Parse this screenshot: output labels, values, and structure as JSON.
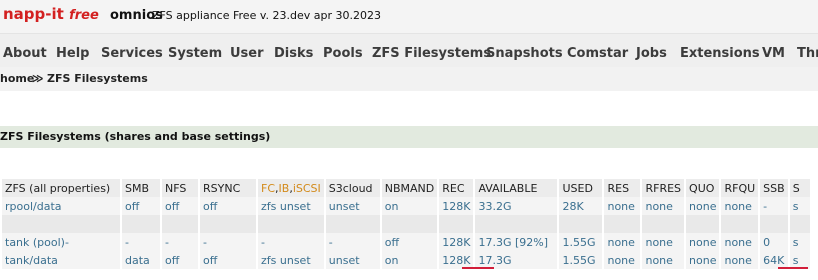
{
  "header": {
    "logo_napp": "napp-it",
    "logo_free": "free",
    "logo_omnios": "omnios",
    "version": "ZFS appliance Free v. 23.dev apr 30.2023"
  },
  "nav": [
    "About",
    "Help",
    "Services",
    "System",
    "User",
    "Disks",
    "Pools",
    "ZFS Filesystems",
    "Snapshots",
    "Comstar",
    "Jobs",
    "Extensions",
    "VM",
    "Thr"
  ],
  "breadcrumb": {
    "home": "home",
    "sep": "≫",
    "current": "ZFS Filesystems"
  },
  "section_title": "ZFS Filesystems (shares and base settings)",
  "table": {
    "headers": {
      "name": "ZFS (all properties)",
      "smb": "SMB",
      "nfs": "NFS",
      "rsync": "RSYNC",
      "fc_a": "FC",
      "fc_b": "IB",
      "fc_c": "iSCSI",
      "s3": "S3cloud",
      "nbmand": "NBMAND",
      "rec": "REC",
      "available": "AVAILABLE",
      "used": "USED",
      "res": "RES",
      "rfres": "RFRES",
      "quo": "QUO",
      "rfqu": "RFQU",
      "ssb": "SSB",
      "extra": "S"
    },
    "rows": [
      {
        "name": "rpool/data",
        "smb": "off",
        "nfs": "off",
        "rsync": "off",
        "fc": "zfs unset",
        "s3": "unset",
        "nbmand": "on",
        "rec": "128K",
        "available": "33.2G",
        "used": "28K",
        "res": "none",
        "rfres": "none",
        "quo": "none",
        "rfqu": "none",
        "ssb": "-",
        "extra": "s"
      },
      {
        "name": "tank (pool)-",
        "smb": "-",
        "nfs": "-",
        "rsync": "-",
        "fc": "-",
        "s3": "-",
        "nbmand": "off",
        "rec": "128K",
        "available": "17.3G [92%]",
        "used": "1.55G",
        "res": "none",
        "rfres": "none",
        "quo": "none",
        "rfqu": "none",
        "ssb": "0",
        "extra": "s"
      },
      {
        "name": "tank/data",
        "smb": "data",
        "nfs": "off",
        "rsync": "off",
        "fc": "zfs unset",
        "s3": "unset",
        "nbmand": "on",
        "rec": "128K",
        "available": "17.3G",
        "used": "1.55G",
        "res": "none",
        "rfres": "none",
        "quo": "none",
        "rfqu": "none",
        "ssb": "64K",
        "extra": "s"
      }
    ]
  },
  "colors": {
    "brand_red": "#d32020",
    "link_blue": "#3a6f8f",
    "header_orange": "#d38a1a",
    "section_green": "#e2eadf",
    "underline_red": "#d21e3a"
  }
}
